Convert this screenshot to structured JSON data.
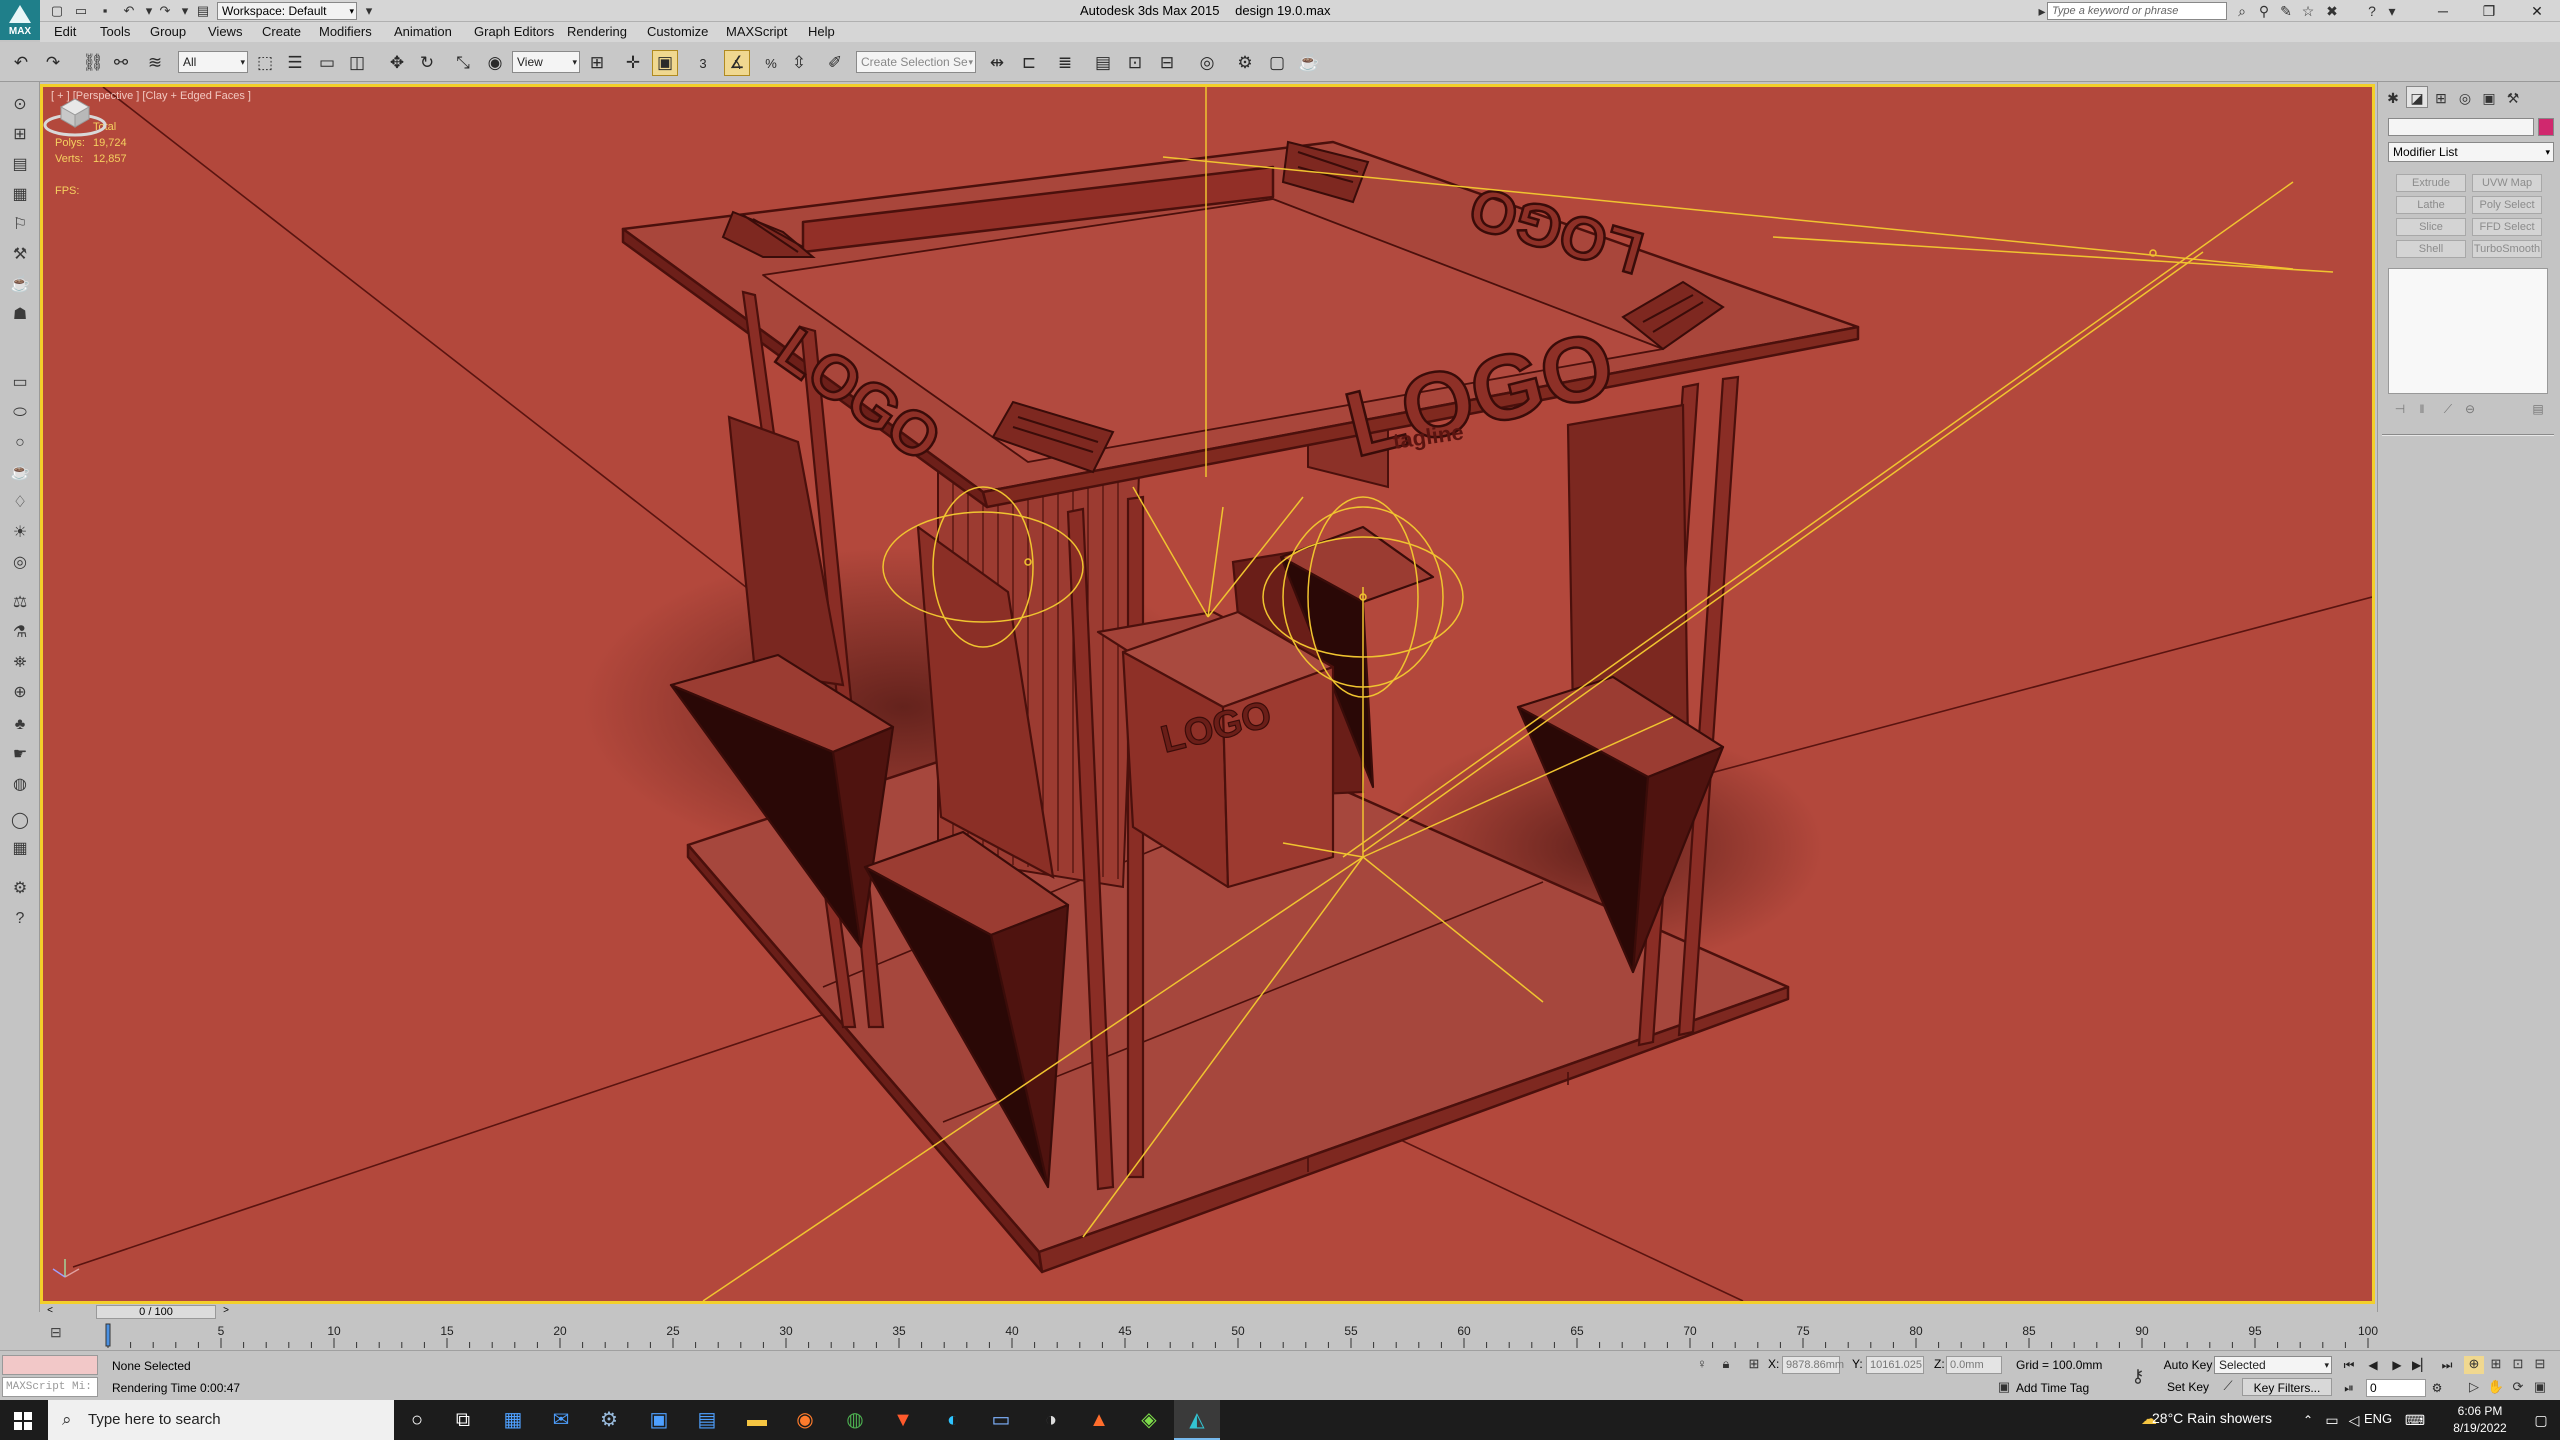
{
  "titlebar": {
    "app_logo": "MAX",
    "workspace_label": "Workspace: Default",
    "app_name": "Autodesk 3ds Max  2015",
    "file_name": "design 19.0.max",
    "help_search_placeholder": "Type a keyword or phrase"
  },
  "menu": [
    "Edit",
    "Tools",
    "Group",
    "Views",
    "Create",
    "Modifiers",
    "Animation",
    "Graph Editors",
    "Rendering",
    "Customize",
    "MAXScript",
    "Help"
  ],
  "toolbar": {
    "selection_filter": "All",
    "ref_coord": "View",
    "named_selection_placeholder": "Create Selection Se",
    "snap_label": "3",
    "angle_snap_label": "%"
  },
  "viewport": {
    "label": "[ + ] [Perspective ] [Clay + Edged Faces ]",
    "stats": {
      "total_label": "Total",
      "polys_label": "Polys:",
      "polys_value": "19,724",
      "verts_label": "Verts:",
      "verts_value": "12,857",
      "fps_label": "FPS:"
    },
    "scene_text": {
      "front_logo": "LOGO",
      "side_logo": "LOGO",
      "top_logo": "LOGO",
      "counter_logo": "LOGO",
      "tagline": "tagline"
    },
    "colors": {
      "background": "#b3483c",
      "wire": "#5a1410",
      "helper": "#f0c430",
      "frame": "#f3cf2a"
    }
  },
  "command_panel": {
    "modifier_list": "Modifier List",
    "buttons": [
      "Extrude",
      "UVW Map",
      "Lathe",
      "Poly Select",
      "Slice",
      "FFD Select",
      "Shell",
      "TurboSmooth"
    ]
  },
  "time_slider": {
    "frame_display": "0 / 100",
    "ticks": [
      "5",
      "10",
      "15",
      "20",
      "25",
      "30",
      "35",
      "40",
      "45",
      "50",
      "55",
      "60",
      "65",
      "70",
      "75",
      "80",
      "85",
      "90",
      "95",
      "100"
    ]
  },
  "status": {
    "maxscript_placeholder": "MAXScript Mi:",
    "selection": "None Selected",
    "prompt": "Rendering Time  0:00:47",
    "x_label": "X:",
    "x_value": "9878.86mm",
    "y_label": "Y:",
    "y_value": "10161.025",
    "z_label": "Z:",
    "z_value": "0.0mm",
    "grid": "Grid = 100.0mm",
    "add_time_tag": "Add Time Tag",
    "auto_key": "Auto Key",
    "set_key": "Set Key",
    "selected_option": "Selected",
    "key_filters": "Key Filters...",
    "current_frame": "0"
  },
  "taskbar": {
    "search_placeholder": "Type here to search",
    "weather": "28°C  Rain showers",
    "language": "ENG",
    "time": "6:06 PM",
    "date": "8/19/2022"
  }
}
